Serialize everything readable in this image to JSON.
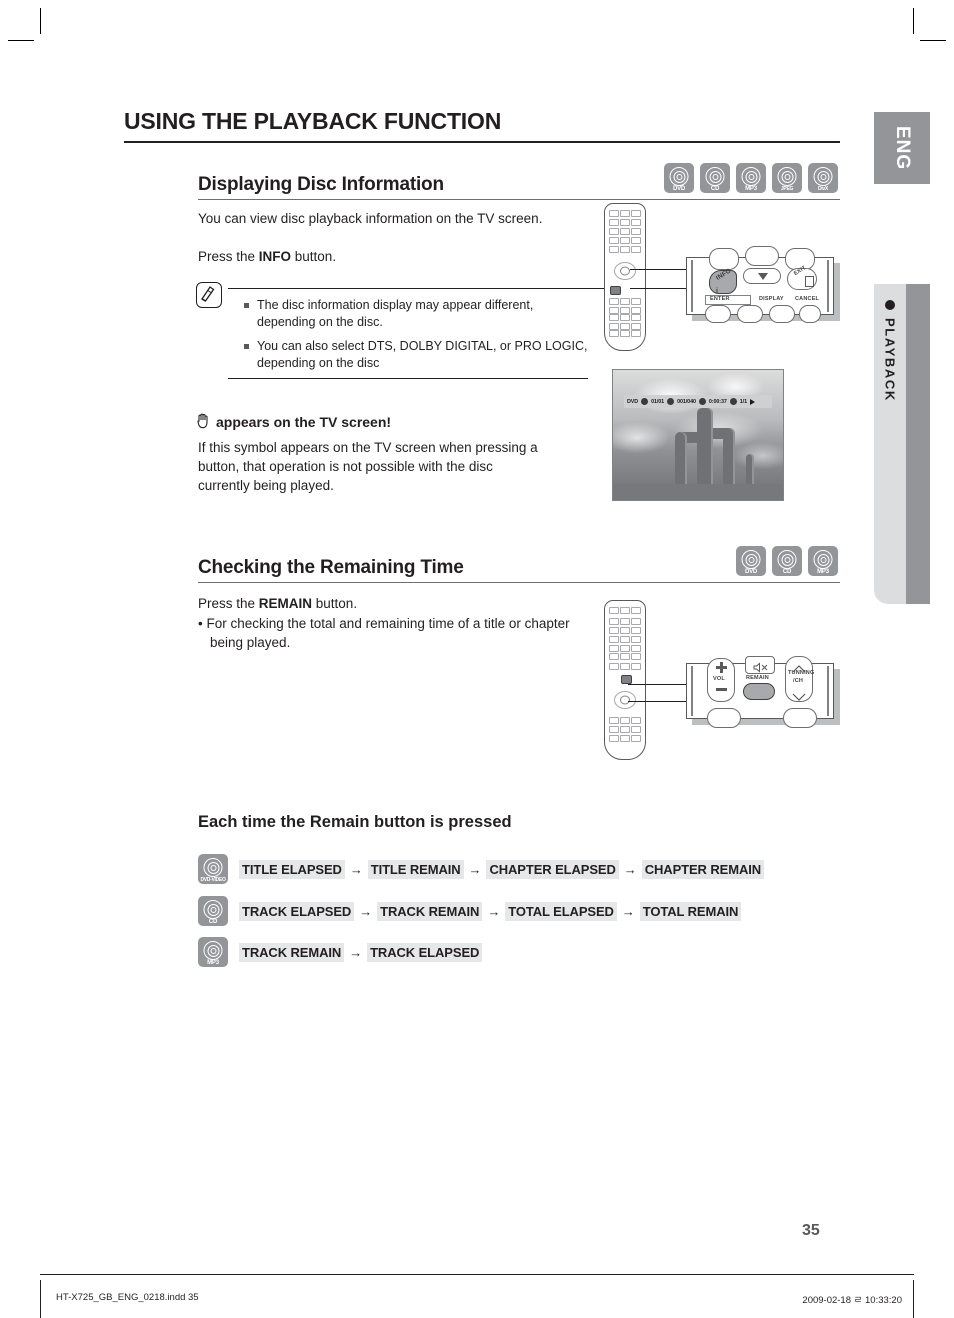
{
  "page": {
    "title": "USING THE PLAYBACK FUNCTION",
    "number": "35"
  },
  "side_tabs": {
    "language": "ENG",
    "chapter": "PLAYBACK"
  },
  "section_disc_info": {
    "heading": "Displaying Disc Information",
    "disc_icons": [
      "DVD",
      "CD",
      "MP3",
      "JPEG",
      "DivX"
    ],
    "intro": "You can view disc playback information  on the TV screen.",
    "press_prefix": "Press the ",
    "press_button": "INFO",
    "press_suffix": " button.",
    "notes": [
      "The disc information display may appear different, depending on the disc.",
      "You can also  select DTS, DOLBY DIGITAL, or PRO LOGIC, depending on the disc"
    ],
    "note_icon": "note-pencil-icon",
    "hand_heading": "appears on the TV screen!",
    "hand_icon": "hand-stop-icon",
    "hand_body": "If this symbol appears on the TV screen when pressing a button, that operation is not possible with the disc currently being played."
  },
  "remote_callout_info": {
    "highlighted_button": "INFO",
    "button_sub": "i",
    "labels": [
      "ENTER",
      "DISPLAY",
      "CANCEL",
      "EXIT"
    ],
    "nav_down_icon": "triangle-down-icon"
  },
  "tv_screen": {
    "osd": {
      "disc_type": "DVD",
      "title_icon": "title-icon",
      "title_value": "01/01",
      "chapter_icon": "chapter-icon",
      "chapter_value": "001/040",
      "time_icon": "clock-icon",
      "time_value": "0:00:37",
      "audio_icon": "audio-icon",
      "audio_value": "1/1",
      "play_icon": "play-icon"
    },
    "image_description": "saguaro cactus against cloudy sky"
  },
  "section_remaining": {
    "heading": "Checking the Remaining Time",
    "disc_icons": [
      "DVD",
      "CD",
      "MP3"
    ],
    "press_prefix": "Press the ",
    "press_button": "REMAIN",
    "press_suffix": " button.",
    "bullet": "For checking the total and remaining time of a title or chapter being played."
  },
  "remote_callout_remain": {
    "highlighted_button": "REMAIN",
    "labels": [
      "VOL",
      "TUNNING",
      "/CH"
    ],
    "mute_icon": "mute-icon",
    "vol_up_icon": "plus-icon",
    "vol_down_icon": "minus-icon",
    "ch_up_icon": "chevron-up-icon",
    "ch_down_icon": "chevron-down-icon"
  },
  "remain_sequence": {
    "title": "Each time the Remain button is pressed",
    "arrow": "→",
    "rows": [
      {
        "icon": "DVD-VIDEO",
        "steps": [
          "TITLE ELAPSED",
          "TITLE REMAIN",
          "CHAPTER ELAPSED",
          "CHAPTER REMAIN"
        ]
      },
      {
        "icon": "CD",
        "steps": [
          "TRACK ELAPSED",
          "TRACK REMAIN",
          "TOTAL ELAPSED",
          "TOTAL REMAIN"
        ]
      },
      {
        "icon": "MP3",
        "steps": [
          "TRACK REMAIN",
          "TRACK ELAPSED"
        ]
      }
    ]
  },
  "footer": {
    "left": "HT-X725_GB_ENG_0218.indd   35",
    "right": "2009-02-18   ㄹ 10:33:20"
  },
  "colors": {
    "gray_tab": "#939598",
    "light_tab": "#dcdddf",
    "token_bg": "#e6e7e8",
    "text": "#231f20"
  }
}
